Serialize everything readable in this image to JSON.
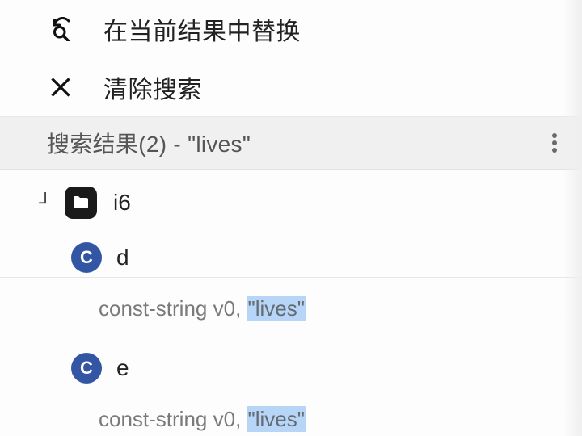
{
  "actions": {
    "replace_label": "在当前结果中替换",
    "clear_label": "清除搜索"
  },
  "results_bar": {
    "title": "搜索结果(2) - \"lives\""
  },
  "tree": {
    "folder_name": "i6",
    "collapse_glyph": "┘",
    "items": [
      {
        "badge": "C",
        "name": "d",
        "code_prefix": "const-string v0, ",
        "code_highlight": "\"lives\""
      },
      {
        "badge": "C",
        "name": "e",
        "code_prefix": "const-string v0, ",
        "code_highlight": "\"lives\""
      }
    ]
  }
}
